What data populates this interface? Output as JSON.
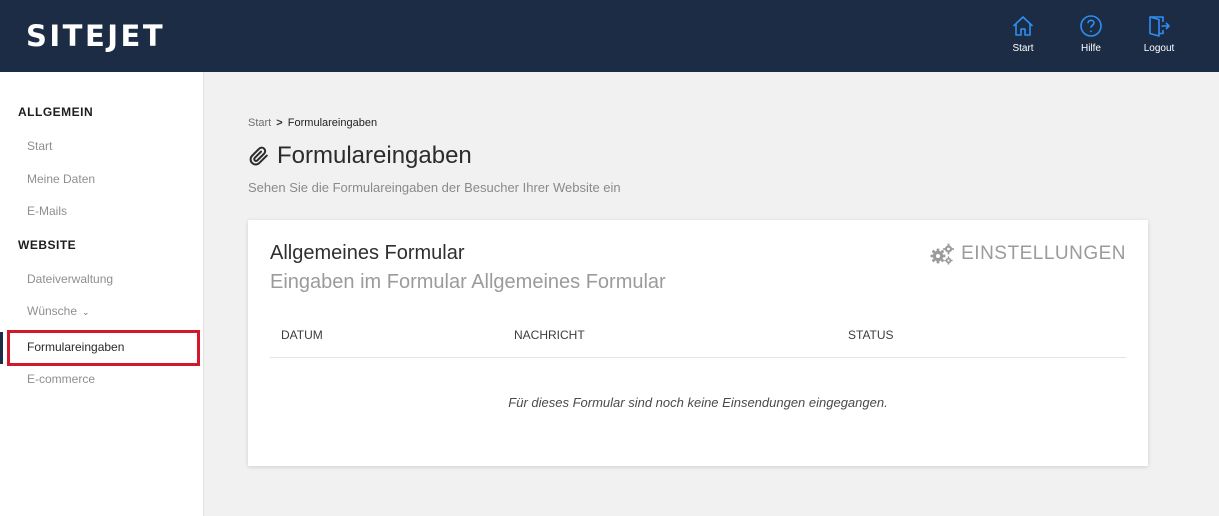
{
  "app": {
    "logo": "SITEJET"
  },
  "top_nav": [
    {
      "icon": "home-icon",
      "label": "Start"
    },
    {
      "icon": "help-icon",
      "label": "Hilfe"
    },
    {
      "icon": "logout-icon",
      "label": "Logout"
    }
  ],
  "sidebar": {
    "sections": [
      {
        "title": "ALLGEMEIN",
        "items": [
          {
            "label": "Start"
          },
          {
            "label": "Meine Daten"
          },
          {
            "label": "E-Mails"
          }
        ]
      },
      {
        "title": "WEBSITE",
        "items": [
          {
            "label": "Dateiverwaltung"
          },
          {
            "label": "Wünsche"
          },
          {
            "label": "Formulareingaben"
          },
          {
            "label": "E-commerce"
          }
        ]
      }
    ],
    "active_item": "Formulareingaben"
  },
  "breadcrumb": {
    "root": "Start",
    "separator": ">",
    "current": "Formulareingaben"
  },
  "page": {
    "title": "Formulareingaben",
    "title_icon": "paperclip-icon",
    "subtitle": "Sehen Sie die Formulareingaben der Besucher Ihrer Website ein"
  },
  "card": {
    "title": "Allgemeines Formular",
    "subtitle": "Eingaben im Formular Allgemeines Formular",
    "settings_label": "EINSTELLUNGEN",
    "settings_icon": "gears-icon",
    "columns": [
      "DATUM",
      "NACHRICHT",
      "STATUS"
    ],
    "empty_message": "Für dieses Formular sind noch keine Einsendungen eingegangen."
  },
  "colors": {
    "topbar": "#1c2c45",
    "icon_accent": "#2f8ef4",
    "active_highlight": "#d3182b"
  }
}
